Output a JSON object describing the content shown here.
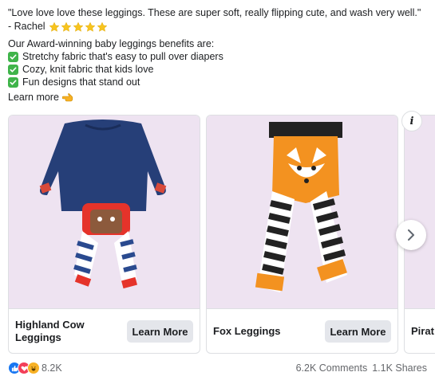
{
  "post": {
    "quote": "\"Love love love these leggings. These are super soft, really flipping cute, and wash very well.\"",
    "author": "- Rachel",
    "rating_stars": 5,
    "intro": "Our Award-winning baby leggings benefits are:",
    "benefits": [
      "Stretchy fabric that's easy to pull over diapers",
      "Cozy, knit fabric that kids love",
      "Fun designs that stand out"
    ],
    "learn_more": "Learn more",
    "learn_more_icon": "pointing-hand-icon"
  },
  "carousel": {
    "cards": [
      {
        "title": "Highland Cow Leggings",
        "cta": "Learn More",
        "image_bg": "#eee3f1"
      },
      {
        "title": "Fox Leggings",
        "cta": "Learn More",
        "image_bg": "#eee3f1"
      },
      {
        "title": "Pirat",
        "image_bg": "#eee3f1"
      }
    ],
    "info_icon": "info-icon",
    "next_icon": "chevron-right-icon"
  },
  "engagement": {
    "reaction_icons": [
      "like-icon",
      "love-icon",
      "haha-icon"
    ],
    "reaction_count": "8.2K",
    "comments": "6.2K Comments",
    "shares": "1.1K Shares"
  },
  "colors": {
    "check_green": "#3fb44a",
    "card_bg": "#eee3f1",
    "like_blue": "#1877f2",
    "love_red": "#f33e58",
    "haha_yellow": "#f7b125"
  }
}
